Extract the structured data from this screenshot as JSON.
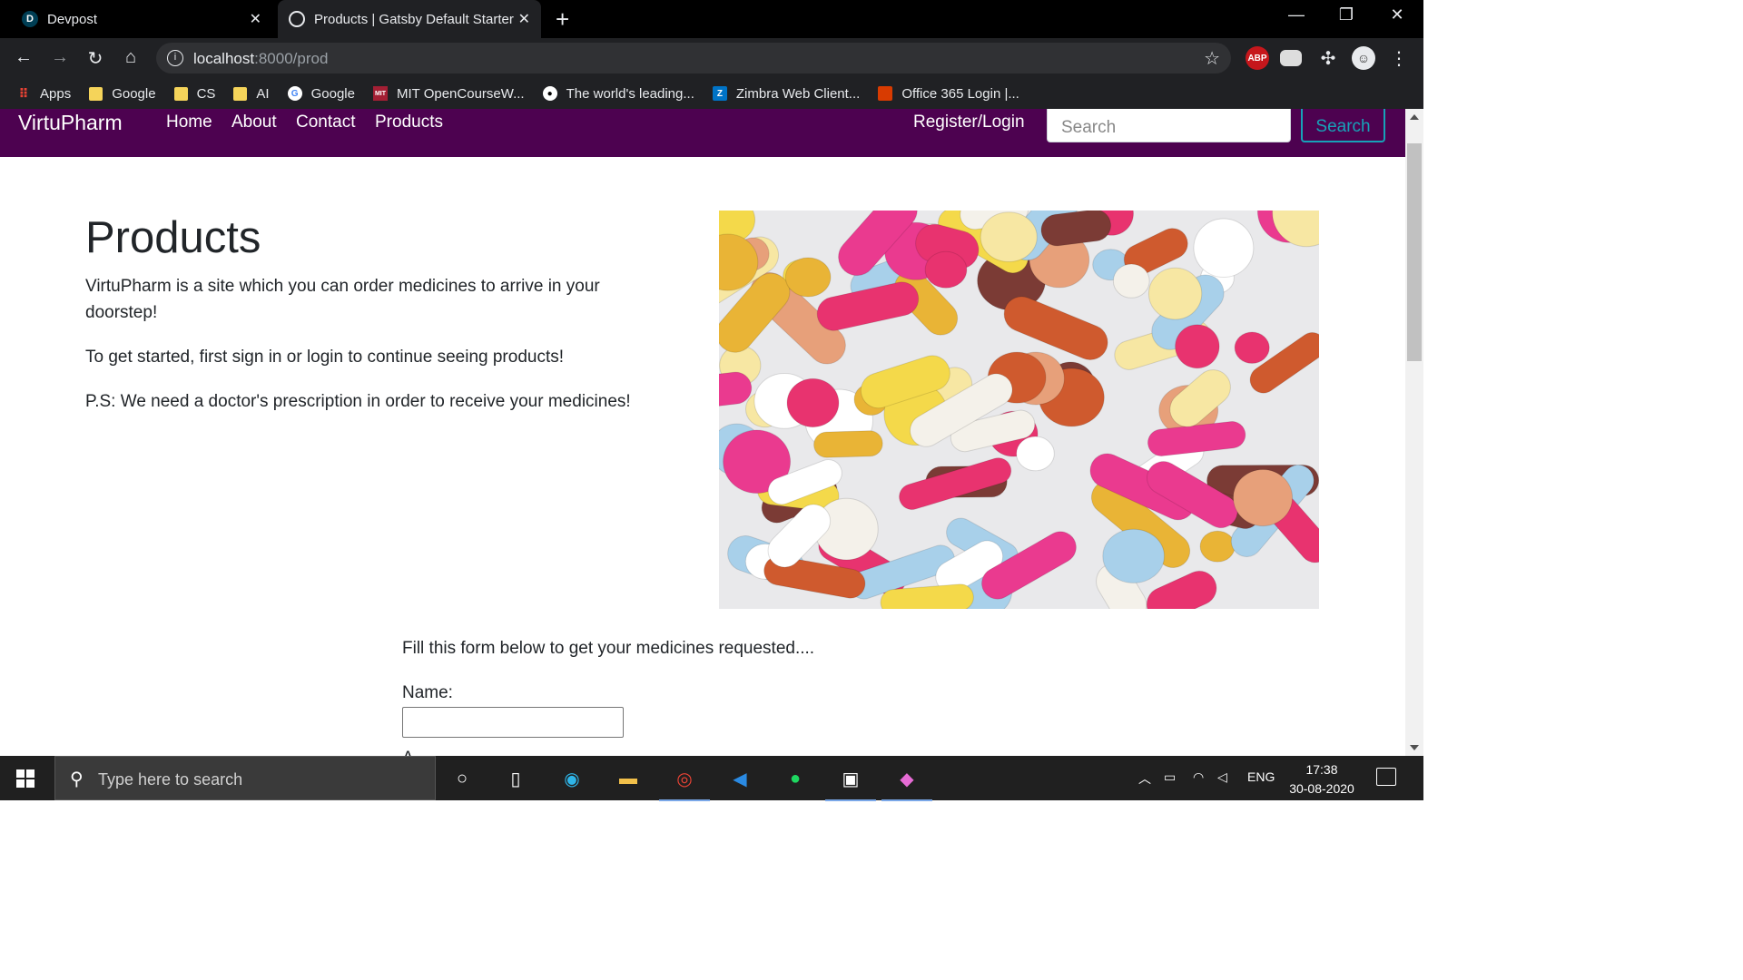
{
  "browser": {
    "tabs": [
      {
        "favicon": "D",
        "title": "Devpost"
      },
      {
        "favicon": "",
        "title": "Products | Gatsby Default Starter"
      }
    ],
    "url_host": "localhost",
    "url_path": ":8000/prod",
    "bookmarks": [
      {
        "icon": "apps-grid-icon",
        "label": "Apps"
      },
      {
        "icon": "folder-icon",
        "label": "Google"
      },
      {
        "icon": "folder-icon",
        "label": "CS"
      },
      {
        "icon": "folder-icon",
        "label": "AI"
      },
      {
        "icon": "google-icon",
        "label": "Google"
      },
      {
        "icon": "mit-ocw-icon",
        "label": "MIT OpenCourseW..."
      },
      {
        "icon": "github-icon",
        "label": "The world's leading..."
      },
      {
        "icon": "zimbra-icon",
        "label": "Zimbra Web Client..."
      },
      {
        "icon": "office365-icon",
        "label": "Office 365 Login |..."
      }
    ],
    "extensions": [
      {
        "icon": "adblock-plus-icon",
        "label": "ABP"
      }
    ]
  },
  "navbar": {
    "brand": "VirtuPharm",
    "links": [
      "Home",
      "About",
      "Contact",
      "Products"
    ],
    "register_login": "Register/Login",
    "search_placeholder": "Search",
    "search_button": "Search"
  },
  "main": {
    "title": "Products",
    "paragraphs": [
      "VirtuPharm is a site which you can order medicines to arrive in your doorstep!",
      "To get started, first sign in or login to continue seeing products!",
      "P.S: We need a doctor's prescription in order to receive your medicines!"
    ],
    "form_intro": "Fill this form below to get your medicines requested....",
    "name_label": "Name:",
    "name_value": "",
    "next_label_partial": "A"
  },
  "taskbar": {
    "search_placeholder": "Type here to search",
    "language": "ENG",
    "time": "17:38",
    "date": "30-08-2020"
  },
  "colors": {
    "navbar_bg": "#4d0250",
    "search_button": "#17a2b8",
    "chrome_dark": "#202124"
  }
}
